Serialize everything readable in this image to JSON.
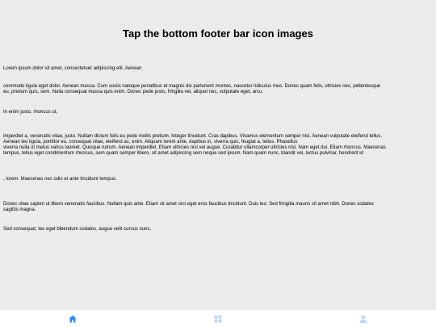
{
  "header": {
    "title": "Tap the bottom footer bar icon images"
  },
  "paragraphs": [
    "Lorem ipsum dolor sit amet, consectetuer adipiscing elit. Aenean",
    "commodo ligula eget dolor. Aenean massa. Cum sociis natoque penatibus et magnis dis parturient montes, nascetur ridiculus mus. Donec quam felis, ultricies nec, pellentesque\neu, pretium quis, sem. Nulla consequat massa quis enim. Donec pede justo, fringilla vel, aliquet nec, vulputate eget, arcu.",
    "In enim justo, rhoncus ut,",
    "imperdiet a, venenatis vitae, justo. Nullam dictum felis eu pede mollis pretium. Integer tincidunt. Cras dapibus. Vivamus elementum semper nisi. Aenean vulputate eleifend tellus.\nAenean leo ligula, porttitor eu, consequat vitae, eleifend ac, enim. Aliquam lorem ante, dapibus in, viverra quis, feugiat a, tellus. Phasellus\nviverra nulla ut metus varius laoreet. Quisque rutrum. Aenean imperdiet. Etiam ultricies nisi vel augue. Curabitur ullamcorper ultricies nisi. Nam eget dui. Etiam rhoncus. Maecenas\ntempus, tellus eget condimentum rhoncus, sem quam semper libero, sit amet adipiscing sem neque sed ipsum. Nam quam nunc, blandit vel, luctus pulvinar, hendrerit id",
    ", lorem. Maecenas nec odio et ante tincidunt tempus.",
    "Donec vitae sapien ut libero venenatis faucibus. Nullam quis ante. Etiam sit amet orci eget eros faucibus tincidunt. Duis leo. Sed fringilla mauris sit amet nibh. Donec sodales\nsagittis magna.",
    "Sed consequat, leo eget bibendum sodales, augue velit cursus nunc,"
  ],
  "footer": {
    "items": [
      {
        "icon": "home-icon",
        "color": "#2f8cf0"
      },
      {
        "icon": "grid-icon",
        "color": "#bcd9fb"
      },
      {
        "icon": "user-icon",
        "color": "#bcd9fb"
      }
    ]
  }
}
